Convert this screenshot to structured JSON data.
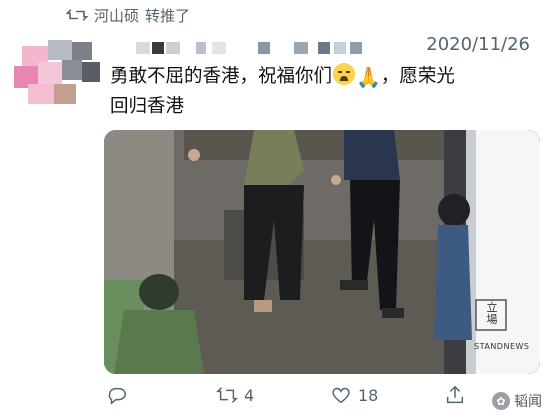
{
  "retweet": {
    "user": "河山硕",
    "action": "转推了"
  },
  "tweet": {
    "timestamp": "2020/11/26",
    "text_part1": "勇敢不屈的香港，祝福你们",
    "text_part2": "，愿荣光",
    "text_line2": "回归香港",
    "emoji1": "loudly-crying-face",
    "emoji2": "folded-hands"
  },
  "media": {
    "logo_text": "立\n場",
    "logo_caption": "STANDNEWS"
  },
  "actions": {
    "reply_count": "",
    "retweet_count": "4",
    "like_count": "18"
  },
  "watermark": {
    "text": "韬闻"
  },
  "colors": {
    "muted_text": "#536471",
    "body_text": "#0f1419"
  }
}
